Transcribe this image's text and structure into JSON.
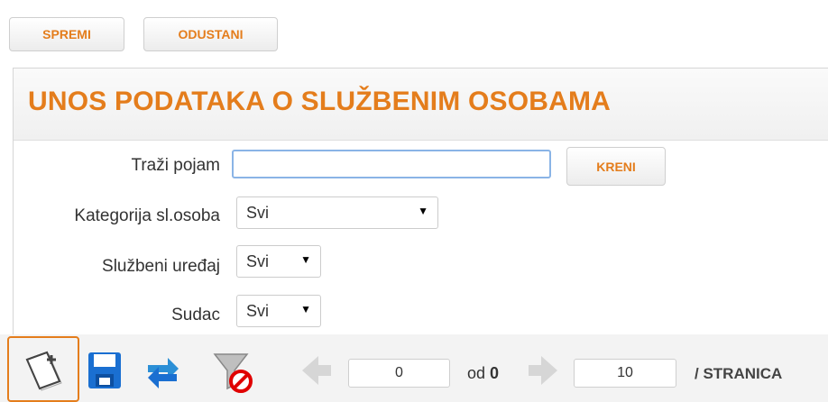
{
  "topbar": {
    "save_label": "SPREMI",
    "cancel_label": "ODUSTANI"
  },
  "header": {
    "title": "UNOS PODATAKA O SLUŽBENIM OSOBAMA"
  },
  "form": {
    "search": {
      "label": "Traži pojam",
      "value": "",
      "button_label": "KRENI"
    },
    "category": {
      "label": "Kategorija sl.osoba",
      "value": "Svi"
    },
    "office": {
      "label": "Službeni uređaj",
      "value": "Svi"
    },
    "judge": {
      "label": "Sudac",
      "value": "Svi"
    }
  },
  "toolbar": {
    "icons": [
      "new-record-icon",
      "save-icon",
      "refresh-icon",
      "clear-filter-icon",
      "prev-page-icon",
      "next-page-icon"
    ],
    "page_current": "0",
    "of_text": "od",
    "page_total": "0",
    "per_page": "10",
    "per_page_text": "/ STRANICA"
  },
  "colors": {
    "accent": "#e47d1c",
    "save_blue": "#1a6fd1",
    "focus_border": "#e47d1c"
  }
}
